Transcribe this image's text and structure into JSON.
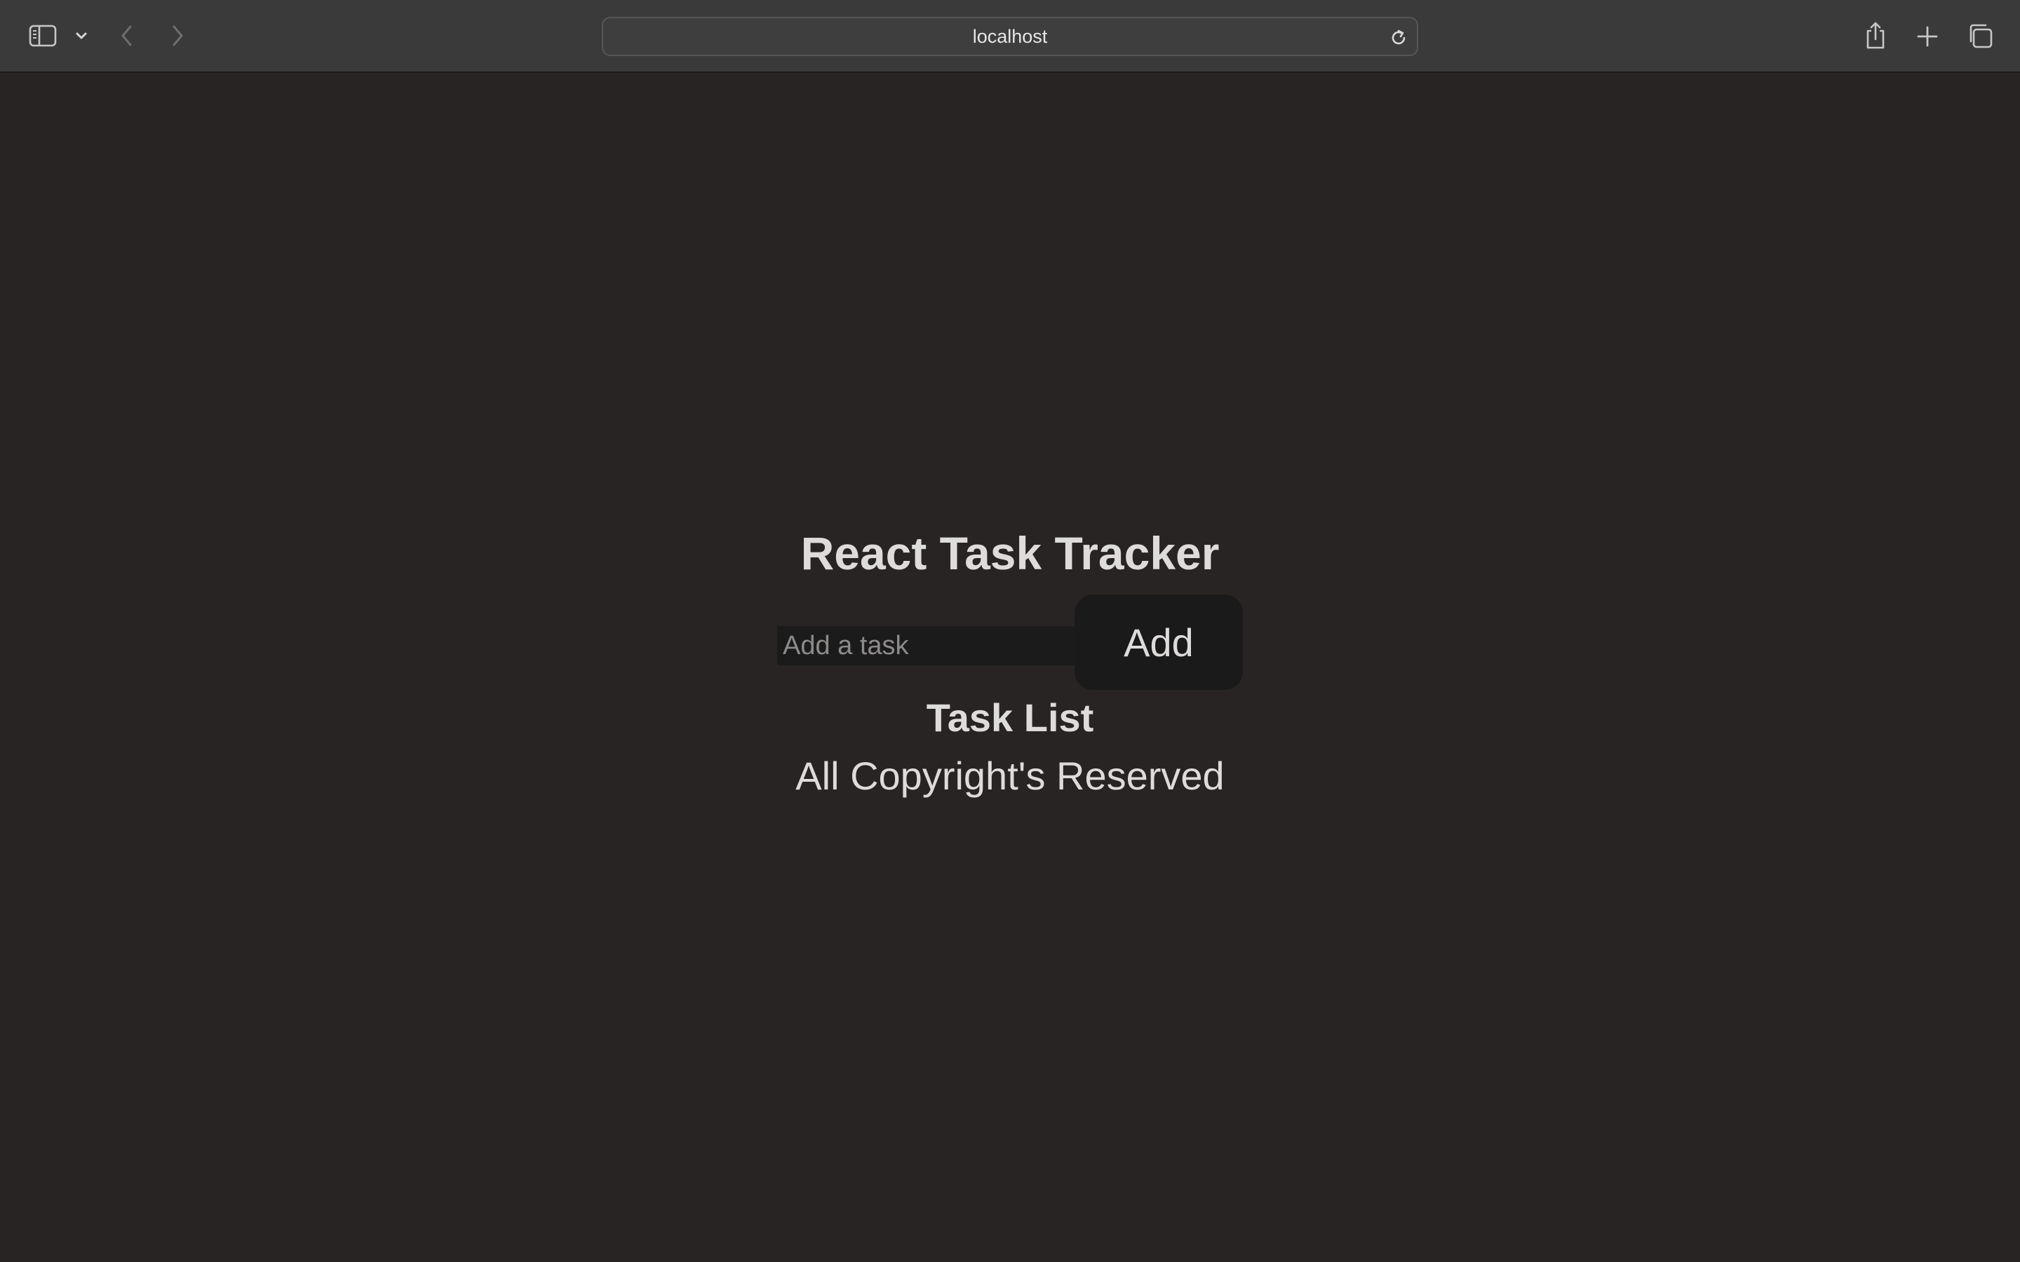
{
  "browser": {
    "address": "localhost",
    "icons": {
      "sidebar": "sidebar-icon",
      "sidebar_menu": "chevron-down-icon",
      "back": "chevron-left-icon",
      "forward": "chevron-right-icon",
      "reload": "reload-icon",
      "share": "share-icon",
      "new_tab": "plus-icon",
      "tab_overview": "tabs-icon"
    }
  },
  "app": {
    "title": "React Task Tracker",
    "input_placeholder": "Add a task",
    "input_value": "",
    "add_label": "Add",
    "list_heading": "Task List",
    "footer": "All Copyright's Reserved"
  },
  "colors": {
    "page_background": "#272423",
    "toolbar_background": "#3b3a3a",
    "text": "#dedcdb",
    "input_background": "#1c1b1b",
    "button_background": "#1b1a1a"
  }
}
